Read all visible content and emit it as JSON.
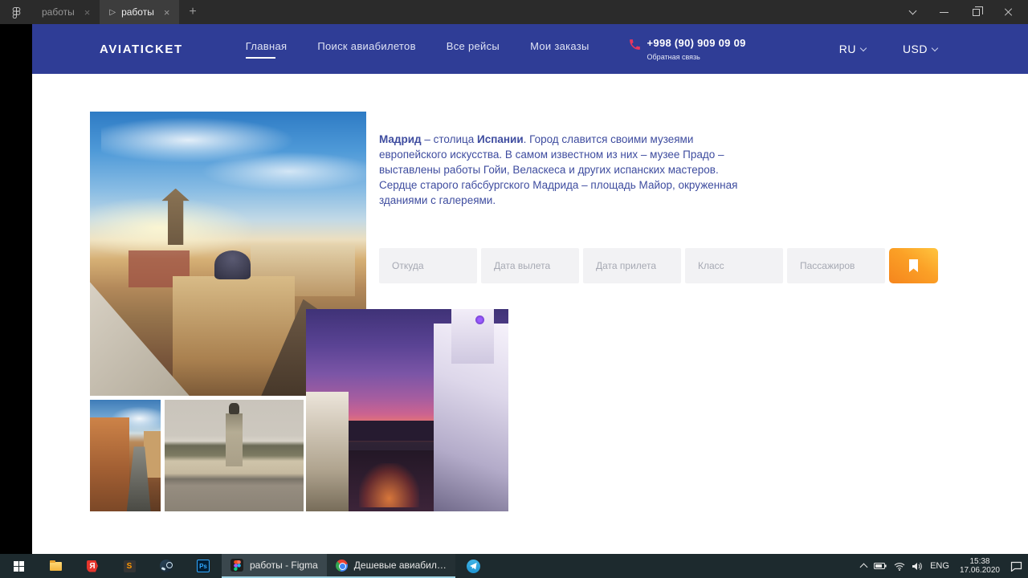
{
  "titlebar": {
    "tab1": "работы",
    "tab2": "работы",
    "play_glyph": "▷",
    "close_glyph": "×",
    "new_tab_glyph": "+"
  },
  "nav": {
    "brand": "AVIATICKET",
    "items": [
      {
        "label": "Главная"
      },
      {
        "label": "Поиск авиабилетов"
      },
      {
        "label": "Все рейсы"
      },
      {
        "label": "Мои заказы"
      }
    ],
    "phone": "+998 (90) 909 09 09",
    "feedback": "Обратная связь",
    "language": "RU",
    "currency": "USD"
  },
  "article": {
    "part1": "Мадрид",
    "part2": " – столица ",
    "part3": "Испании",
    "part4": ". Город славится своими музеями европейского искусства. В самом известном из них – музее Прадо – выставлены работы Гойи, Веласкеса и других испанских мастеров. Сердце старого габсбургского Мадрида – площадь Майор, окруженная зданиями с галереями."
  },
  "search": {
    "fields": [
      "Откуда",
      "Дата вылета",
      "Дата прилета",
      "Класс",
      "Пассажиров"
    ]
  },
  "taskbar": {
    "figma_task": "работы - Figma",
    "chrome_task": "Дешевые авиабил…",
    "sublime_glyph": "S",
    "yandex_glyph": "Я",
    "ps_glyph": "Ps",
    "tray_lang": "ENG",
    "time": "15:38",
    "date": "17.06.2020"
  },
  "colors": {
    "nav_blue": "#2f3d96",
    "article_text": "#3e4c9f",
    "button_orange_light": "#ffc53f",
    "button_orange_dark": "#f5851d",
    "taskbar_bg": "#1d2a2e",
    "task_active_underline": "#9fd4e4",
    "phone_icon_red": "#e8355e"
  }
}
